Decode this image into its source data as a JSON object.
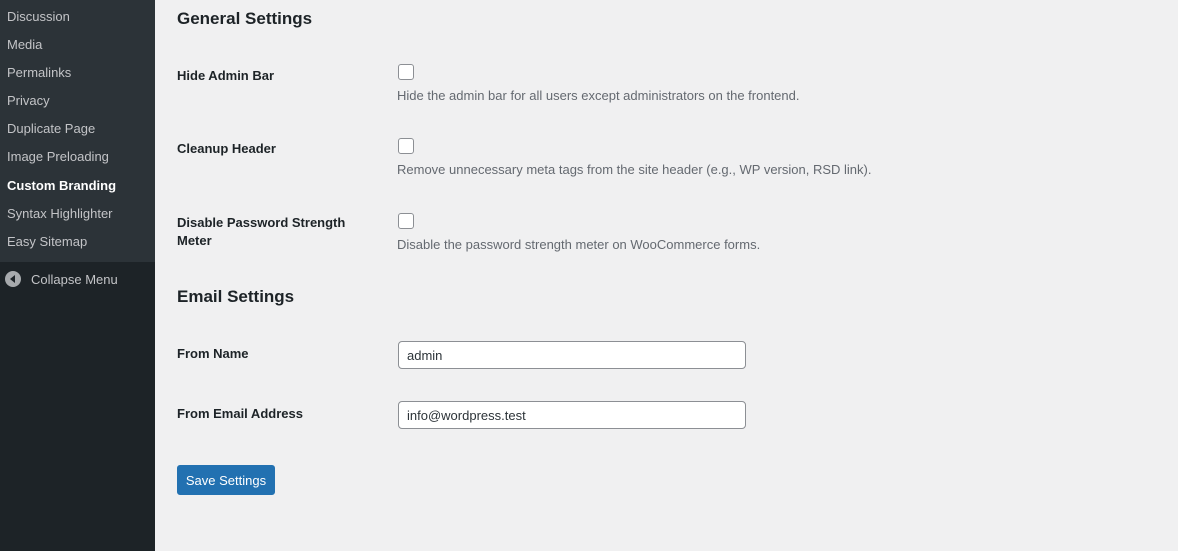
{
  "sidebar": {
    "items": [
      {
        "label": "Discussion"
      },
      {
        "label": "Media"
      },
      {
        "label": "Permalinks"
      },
      {
        "label": "Privacy"
      },
      {
        "label": "Duplicate Page"
      },
      {
        "label": "Image Preloading"
      },
      {
        "label": "Custom Branding",
        "current": true
      },
      {
        "label": "Syntax Highlighter"
      },
      {
        "label": "Easy Sitemap"
      }
    ],
    "collapse_label": "Collapse Menu",
    "collapse_icon": "collapse-arrow-icon"
  },
  "general": {
    "title": "General Settings",
    "rows": [
      {
        "label": "Hide Admin Bar",
        "checked": false,
        "description": "Hide the admin bar for all users except administrators on the frontend."
      },
      {
        "label": "Cleanup Header",
        "checked": false,
        "description": "Remove unnecessary meta tags from the site header (e.g., WP version, RSD link)."
      },
      {
        "label": "Disable Password Strength Meter",
        "checked": false,
        "description": "Disable the password strength meter on WooCommerce forms."
      }
    ]
  },
  "email": {
    "title": "Email Settings",
    "from_name": {
      "label": "From Name",
      "value": "admin"
    },
    "from_email": {
      "label": "From Email Address",
      "value": "info@wordpress.test"
    }
  },
  "save_label": "Save Settings",
  "colors": {
    "sidebar_bg": "#1d2327",
    "submenu_bg": "#2c3338",
    "accent": "#2271b1",
    "page_bg": "#f0f0f1"
  }
}
